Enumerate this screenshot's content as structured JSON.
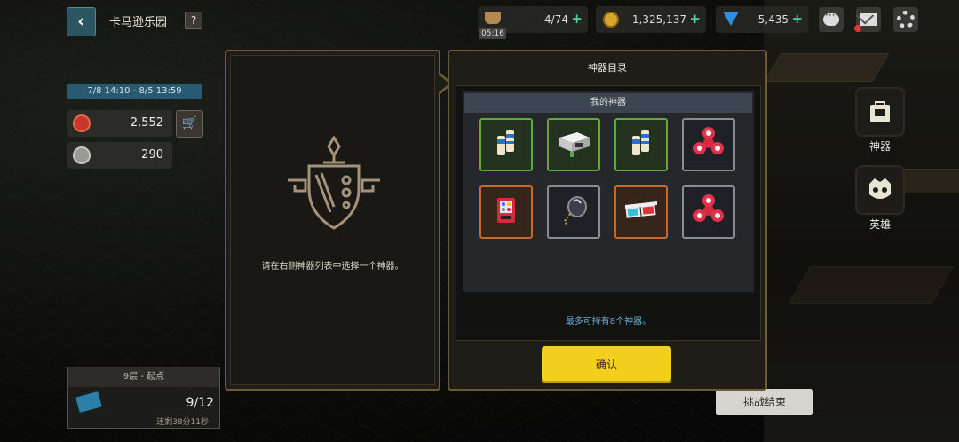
{
  "header": {
    "title": "卡马逊乐园",
    "help_label": "?",
    "stamina": {
      "value": "4/74",
      "timer": "05:16"
    },
    "coins": {
      "value": "1,325,137"
    },
    "gems": {
      "value": "5,435"
    },
    "plus_label": "+"
  },
  "event": {
    "date_range": "7/8 14:10 - 8/5 13:59",
    "currency_a": "2,552",
    "currency_b": "290"
  },
  "floor": {
    "title": "9层 - 起点",
    "progress": "9/12",
    "remaining": "还剩38分11秒"
  },
  "side_nav": {
    "artifact_label": "神器",
    "hero_label": "英雄"
  },
  "end_challenge_label": "挑战结束",
  "left_panel": {
    "hint": "请在右侧神器列表中选择一个神器。"
  },
  "right_panel": {
    "title": "神器目录",
    "subtitle": "我的神器",
    "note": "最多可持有8个神器。",
    "slots": [
      {
        "icon": "bottles-icon",
        "rarity": "green"
      },
      {
        "icon": "projector-icon",
        "rarity": "green"
      },
      {
        "icon": "bottles-icon",
        "rarity": "green"
      },
      {
        "icon": "fidget-spinner-icon",
        "rarity": "gray"
      },
      {
        "icon": "vending-machine-icon",
        "rarity": "orange"
      },
      {
        "icon": "mirror-pendant-icon",
        "rarity": "gray"
      },
      {
        "icon": "3d-glasses-icon",
        "rarity": "orange"
      },
      {
        "icon": "fidget-spinner-icon",
        "rarity": "gray"
      }
    ]
  },
  "confirm_label": "确认",
  "colors": {
    "panel_border": "#6e5a35",
    "rarity_green": "#5faa3c",
    "rarity_orange": "#c7692d",
    "rarity_gray": "#8a8c90",
    "confirm_yellow": "#f2cf1c",
    "note_blue": "#6ab2d8"
  }
}
